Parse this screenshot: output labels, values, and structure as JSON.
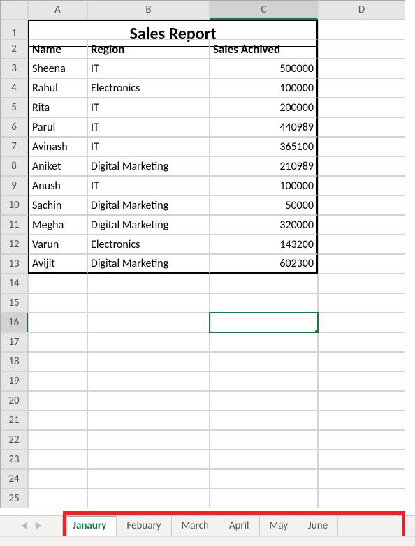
{
  "title": "Sales Report",
  "colHeaders": [
    "A",
    "B",
    "C",
    "D"
  ],
  "rowHeaders": [
    "1",
    "2",
    "3",
    "4",
    "5",
    "6",
    "7",
    "8",
    "9",
    "10",
    "11",
    "12",
    "13",
    "14",
    "15",
    "16",
    "17",
    "18",
    "19",
    "20",
    "21",
    "22",
    "23",
    "24",
    "25"
  ],
  "columns": [
    "Name",
    "Region",
    "Sales Achived"
  ],
  "rows": [
    {
      "name": "Sheena",
      "region": "IT",
      "sales": "500000"
    },
    {
      "name": "Rahul",
      "region": "Electronics",
      "sales": "100000"
    },
    {
      "name": "Rita",
      "region": "IT",
      "sales": "200000"
    },
    {
      "name": "Parul",
      "region": "IT",
      "sales": "440989"
    },
    {
      "name": "Avinash",
      "region": "IT",
      "sales": "365100"
    },
    {
      "name": "Aniket",
      "region": "Digital Marketing",
      "sales": "210989"
    },
    {
      "name": "Anush",
      "region": "IT",
      "sales": "100000"
    },
    {
      "name": "Sachin",
      "region": "Digital Marketing",
      "sales": "50000"
    },
    {
      "name": "Megha",
      "region": "Digital Marketing",
      "sales": "320000"
    },
    {
      "name": "Varun",
      "region": "Electronics",
      "sales": "143200"
    },
    {
      "name": "Avijit",
      "region": "Digital Marketing",
      "sales": "602300"
    }
  ],
  "activeCell": {
    "row": 16,
    "col": "C"
  },
  "tabs": [
    "Janaury",
    "Febuary",
    "March",
    "April",
    "May",
    "June"
  ],
  "activeTab": "Janaury",
  "chart_data": {
    "type": "table",
    "title": "Sales Report",
    "columns": [
      "Name",
      "Region",
      "Sales Achived"
    ],
    "data": [
      [
        "Sheena",
        "IT",
        500000
      ],
      [
        "Rahul",
        "Electronics",
        100000
      ],
      [
        "Rita",
        "IT",
        200000
      ],
      [
        "Parul",
        "IT",
        440989
      ],
      [
        "Avinash",
        "IT",
        365100
      ],
      [
        "Aniket",
        "Digital Marketing",
        210989
      ],
      [
        "Anush",
        "IT",
        100000
      ],
      [
        "Sachin",
        "Digital Marketing",
        50000
      ],
      [
        "Megha",
        "Digital Marketing",
        320000
      ],
      [
        "Varun",
        "Electronics",
        143200
      ],
      [
        "Avijit",
        "Digital Marketing",
        602300
      ]
    ]
  }
}
